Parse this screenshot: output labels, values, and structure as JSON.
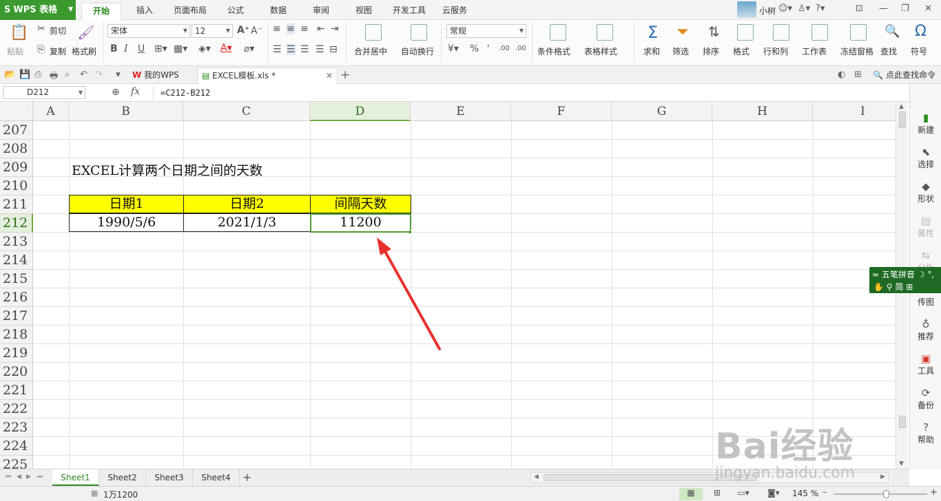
{
  "app": {
    "name": "WPS 表格",
    "logo": "S",
    "user_name": "小树",
    "menu_tabs": [
      {
        "label": "开始",
        "active": true
      },
      {
        "label": "插入",
        "active": false
      },
      {
        "label": "页面布局",
        "active": false
      },
      {
        "label": "公式",
        "active": false
      },
      {
        "label": "数据",
        "active": false
      },
      {
        "label": "审阅",
        "active": false
      },
      {
        "label": "视图",
        "active": false
      },
      {
        "label": "开发工具",
        "active": false
      },
      {
        "label": "云服务",
        "active": false
      }
    ],
    "window_controls": [
      "restore-icon",
      "minimize-icon",
      "maximize-icon",
      "close-icon"
    ]
  },
  "ribbon": {
    "paste": "粘贴",
    "cut": "剪切",
    "copy": "复制",
    "format_painter": "格式刷",
    "font_name": "宋体",
    "font_size": "12",
    "bold": "B",
    "italic": "I",
    "underline": "U",
    "merge_center": "合并居中",
    "wrap_text": "自动换行",
    "number_format": "常规",
    "percent": "%",
    "thousands": " '",
    "inc_decimal": ".00",
    "dec_decimal": ".00",
    "conditional_format": "条件格式",
    "table_style": "表格样式",
    "sum": "求和",
    "filter": "筛选",
    "sort": "排序",
    "format": "格式",
    "row_col": "行和列",
    "worksheet": "工作表",
    "freeze": "冻结窗格",
    "find": "查找",
    "symbol": "符号"
  },
  "tabs": {
    "my_wps": "我的WPS",
    "document": "EXCEL模板.xls *",
    "find_command": "点此查找命令"
  },
  "formula_bar": {
    "cell_ref": "D212",
    "fx": "fx",
    "formula": "=C212-B212"
  },
  "grid": {
    "columns": [
      "A",
      "B",
      "C",
      "D",
      "E",
      "F",
      "G",
      "H",
      "I"
    ],
    "selected_column": "D",
    "rows": [
      "207",
      "208",
      "209",
      "210",
      "211",
      "212",
      "213",
      "214",
      "215",
      "216",
      "217",
      "218",
      "219",
      "220",
      "221",
      "222",
      "223",
      "224",
      "225"
    ],
    "selected_row": "212",
    "title_cell": "EXCEL计算两个日期之间的天数",
    "table": {
      "headers": [
        "日期1",
        "日期2",
        "间隔天数"
      ],
      "values": [
        "1990/5/6",
        "2021/1/3",
        "11200"
      ],
      "header_fill": "#ffff00"
    }
  },
  "sidebar": {
    "items": [
      {
        "label": "新建",
        "icon": "new-doc-icon",
        "enabled": true
      },
      {
        "label": "选择",
        "icon": "select-cursor-icon",
        "enabled": true
      },
      {
        "label": "形状",
        "icon": "shape-icon",
        "enabled": true
      },
      {
        "label": "属性",
        "icon": "properties-icon",
        "enabled": false
      },
      {
        "label": "分析",
        "icon": "analysis-icon",
        "enabled": false
      },
      {
        "label": "传图",
        "icon": "upload-image-icon",
        "enabled": true
      },
      {
        "label": "推荐",
        "icon": "recommend-icon",
        "enabled": true
      },
      {
        "label": "工具",
        "icon": "toolbox-icon",
        "enabled": true
      },
      {
        "label": "备份",
        "icon": "backup-icon",
        "enabled": true
      },
      {
        "label": "帮助",
        "icon": "help-icon",
        "enabled": true
      }
    ]
  },
  "ime": {
    "mode": "五笔拼音",
    "script": "简"
  },
  "sheets": {
    "tabs": [
      "Sheet1",
      "Sheet2",
      "Sheet3",
      "Sheet4"
    ],
    "active": "Sheet1"
  },
  "status": {
    "text": "1万1200",
    "zoom": "145 %",
    "zoom_fraction": 0.56
  },
  "watermark": {
    "brand": "Bai经验",
    "url": "jingyan.baidu.com"
  },
  "colors": {
    "accent": "#2a8b1e",
    "app_button": "#3a9a2e",
    "selection": "#4e9a2e",
    "arrow": "#e8302c"
  }
}
